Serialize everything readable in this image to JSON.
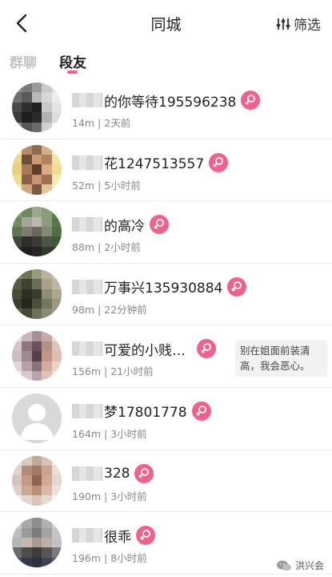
{
  "header": {
    "title": "同城",
    "filter_label": "筛选"
  },
  "tabs": [
    {
      "label": "群聊",
      "active": false
    },
    {
      "label": "段友",
      "active": true
    }
  ],
  "accent_color": "#ff5c86",
  "gender_color": "#f1618c",
  "users": [
    {
      "name": "的你等待195596238",
      "distance": "14m",
      "time": "2天前",
      "gender": "female"
    },
    {
      "name": "花1247513557",
      "distance": "52m",
      "time": "5小时前",
      "gender": "female"
    },
    {
      "name": "的高冷",
      "distance": "88m",
      "time": "2小时前",
      "gender": "female"
    },
    {
      "name": "万事兴135930884",
      "distance": "98m",
      "time": "22分钟前",
      "gender": "female"
    },
    {
      "name": "可爱的小贱…",
      "distance": "156m",
      "time": "21小时前",
      "gender": "female",
      "signature": "别在姐面前装清高，我会恶心。"
    },
    {
      "name": "梦17801778",
      "distance": "164m",
      "time": "3小时前",
      "gender": "female"
    },
    {
      "name": "328",
      "distance": "190m",
      "time": "3小时前",
      "gender": "female"
    },
    {
      "name": "很乖",
      "distance": "196m",
      "time": "8小时前",
      "gender": "female"
    }
  ],
  "watermark": {
    "text": "洪兴会"
  }
}
